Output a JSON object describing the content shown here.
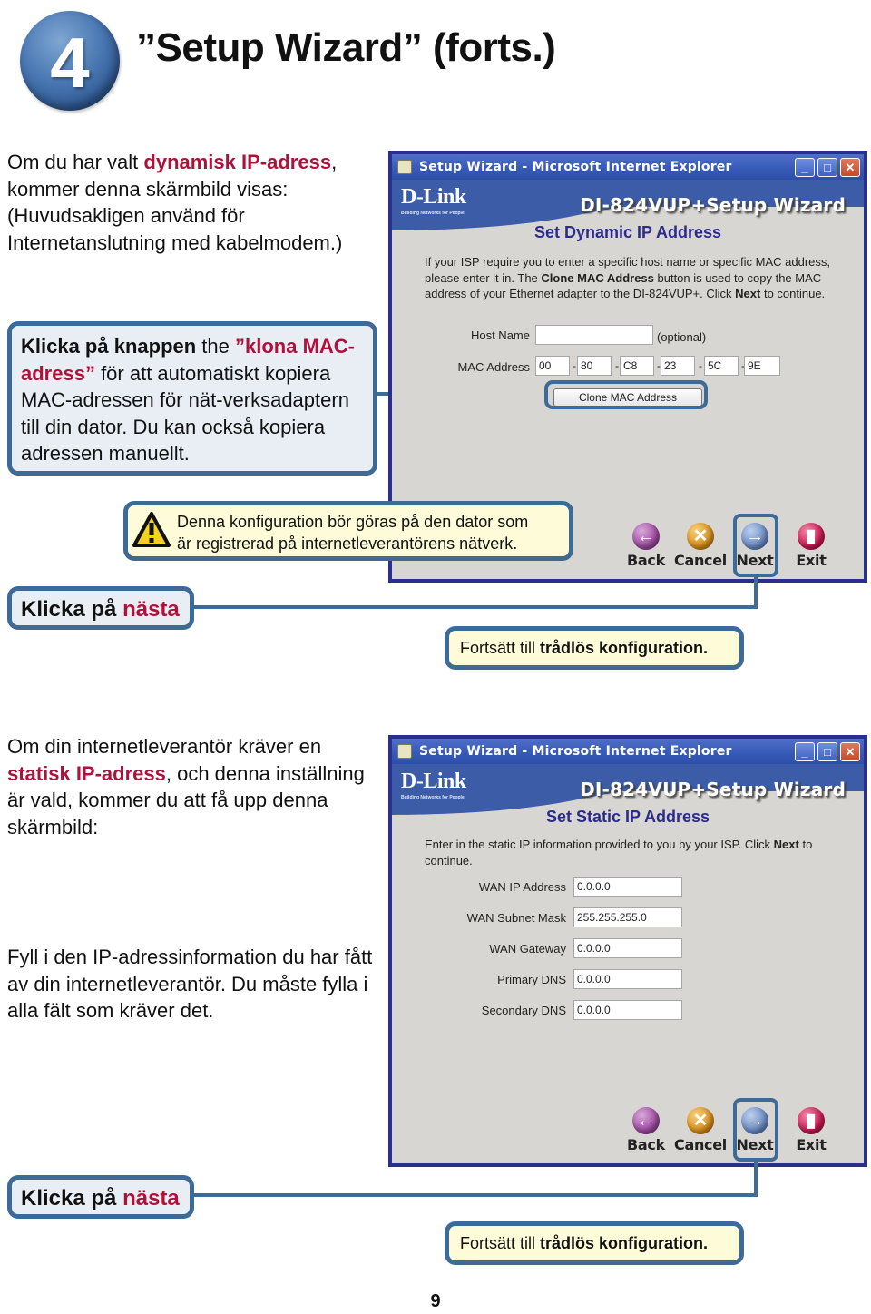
{
  "header": {
    "step_number": "4",
    "title": "”Setup Wizard” (forts.)"
  },
  "section_dynamic": {
    "intro": {
      "pre": "Om du har valt  ",
      "highlight": "dynamisk IP-adress",
      "post": ", kommer denna skärmbild visas:  (Huvudsakligen använd för Internetanslutning med kabelmodem.)"
    },
    "clone_callout": {
      "bold": "Klicka på knappen",
      "mid": " the ",
      "highlight": "”klona MAC-adress”",
      "post": " för att automatiskt kopiera MAC-adressen för nät-verksadaptern till din dator. Du kan också kopiera adressen manuellt."
    },
    "warning_callout": {
      "icon": "warning-icon",
      "line1": "Denna konfiguration bör göras på den dator som",
      "line2": "är registrerad på internetleverantörens nätverk."
    },
    "next_callout": {
      "pre": "Klicka på ",
      "highlight": "nästa"
    },
    "continue_callout": {
      "pre": "Fortsätt till ",
      "bold": "trådlös konfiguration."
    },
    "window": {
      "title": "Setup Wizard - Microsoft Internet Explorer",
      "brand": "D-Link",
      "brand_tagline": "Building Networks for People",
      "wizard_title": "DI-824VUP+Setup Wizard",
      "heading": "Set Dynamic IP Address",
      "description": {
        "p1": "If your ISP require you to enter a specific host name or specific MAC address, please enter it in. The ",
        "b1": "Clone MAC Address",
        "p2": " button is used to copy the MAC address of your Ethernet adapter to the DI-824VUP+. Click ",
        "b2": "Next",
        "p3": " to continue."
      },
      "host_name": {
        "label": "Host Name",
        "value": "",
        "hint": "(optional)"
      },
      "mac_address": {
        "label": "MAC Address",
        "octets": [
          "00",
          "80",
          "C8",
          "23",
          "5C",
          "9E"
        ],
        "separator": "-"
      },
      "clone_button": "Clone MAC Address",
      "nav": {
        "back": "Back",
        "cancel": "Cancel",
        "next": "Next",
        "exit": "Exit"
      }
    }
  },
  "section_static": {
    "intro": {
      "pre": "Om din internetleverantör kräver en ",
      "highlight": "statisk IP-adress",
      "post": ", och denna inställning är vald, kommer du att få upp denna skärmbild:"
    },
    "fill_text": "Fyll i den IP-adressinformation du har fått av din internetleverantör. Du måste fylla i alla fält som kräver det.",
    "next_callout": {
      "pre": "Klicka på ",
      "highlight": "nästa"
    },
    "continue_callout": {
      "pre": "Fortsätt till ",
      "bold": "trådlös konfiguration."
    },
    "window": {
      "title": "Setup Wizard - Microsoft Internet Explorer",
      "brand": "D-Link",
      "brand_tagline": "Building Networks for People",
      "wizard_title": "DI-824VUP+Setup Wizard",
      "heading": "Set Static IP Address",
      "description": {
        "p1": "Enter in the static IP information provided to you by your ISP. Click ",
        "b1": "Next",
        "p2": " to continue."
      },
      "fields": [
        {
          "label": "WAN IP Address",
          "value": "0.0.0.0"
        },
        {
          "label": "WAN Subnet Mask",
          "value": "255.255.255.0"
        },
        {
          "label": "WAN Gateway",
          "value": "0.0.0.0"
        },
        {
          "label": "Primary DNS",
          "value": "0.0.0.0"
        },
        {
          "label": "Secondary DNS",
          "value": "0.0.0.0"
        }
      ],
      "nav": {
        "back": "Back",
        "cancel": "Cancel",
        "next": "Next",
        "exit": "Exit"
      }
    }
  },
  "footer": {
    "page_number": "9"
  },
  "colors": {
    "highlight_red": "#b0113a",
    "callout_border": "#3d6a97",
    "callout_blue_bg": "#e9eef4",
    "callout_yellow_bg": "#fdfbd8",
    "window_frame": "#2a2e8c",
    "window_body": "#d8d6d2",
    "heading_navy": "#2b2b8c"
  }
}
